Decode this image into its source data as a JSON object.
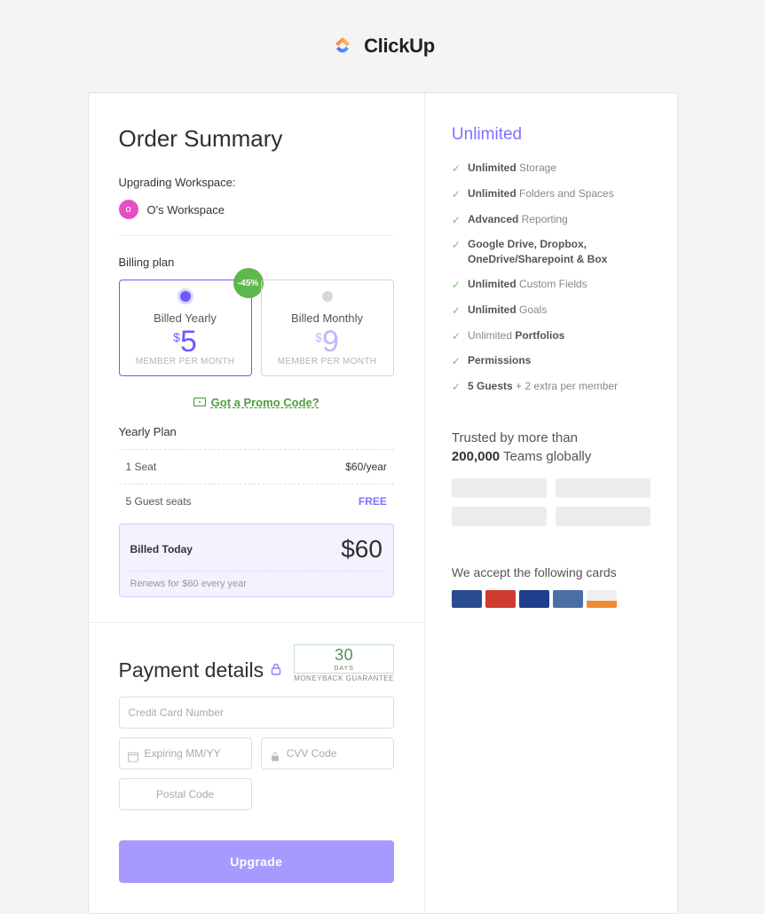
{
  "brand": {
    "name": "ClickUp"
  },
  "summary": {
    "title": "Order Summary",
    "upgrading_label": "Upgrading Workspace:",
    "workspace_initial": "o",
    "workspace_name": "O's Workspace"
  },
  "billing": {
    "section_label": "Billing plan",
    "yearly": {
      "label": "Billed Yearly",
      "price": "5",
      "sub": "MEMBER PER MONTH",
      "discount": "-45%"
    },
    "monthly": {
      "label": "Billed Monthly",
      "price": "9",
      "sub": "MEMBER PER MONTH"
    },
    "promo_link": "Got a Promo Code?"
  },
  "plan_lines": {
    "heading": "Yearly Plan",
    "seat_label": "1 Seat",
    "seat_price": "$60/year",
    "guest_label": "5 Guest seats",
    "guest_price": "FREE",
    "billed_today_label": "Billed Today",
    "billed_today_amount": "$60",
    "renew_text": "Renews for $60 every year"
  },
  "payment": {
    "title": "Payment details",
    "guarantee_num": "30",
    "guarantee_days": "DAYS",
    "guarantee_text": "MONEYBACK GUARANTEE",
    "cc_placeholder": "Credit Card Number",
    "exp_placeholder": "Expiring MM/YY",
    "cvv_placeholder": "CVV Code",
    "postal_placeholder": "Postal Code",
    "button": "Upgrade"
  },
  "right": {
    "plan_name": "Unlimited",
    "features": [
      {
        "bold": "Unlimited",
        "rest": " Storage"
      },
      {
        "bold": "Unlimited",
        "rest": " Folders and Spaces"
      },
      {
        "bold": "Advanced",
        "rest": " Reporting"
      },
      {
        "bold": "Google Drive, Dropbox, OneDrive/Sharepoint & Box",
        "rest": ""
      },
      {
        "bold": "Unlimited",
        "rest": " Custom Fields"
      },
      {
        "bold": "Unlimited",
        "rest": " Goals"
      },
      {
        "bold": "",
        "rest_pre": "Unlimited ",
        "bold2": "Portfolios"
      },
      {
        "bold": "Permissions",
        "rest": ""
      },
      {
        "bold": "5 Guests",
        "rest": " + 2 extra per member"
      }
    ],
    "trusted_line1": "Trusted by more than",
    "trusted_strong": "200,000",
    "trusted_line1b": " Teams globally",
    "accept_label": "We accept the following cards"
  }
}
